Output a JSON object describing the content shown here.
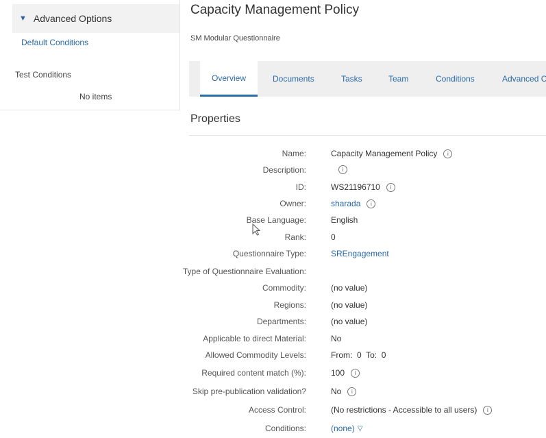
{
  "sidebar": {
    "section_title": "Advanced Options",
    "default_conditions": "Default Conditions",
    "test_conditions": "Test Conditions",
    "no_items": "No items"
  },
  "header": {
    "title": "Capacity Management Policy",
    "subtitle": "SM Modular Questionnaire"
  },
  "tabs": [
    "Overview",
    "Documents",
    "Tasks",
    "Team",
    "Conditions",
    "Advanced C"
  ],
  "properties": {
    "title": "Properties",
    "rows": [
      {
        "label": "Name:",
        "value": "Capacity Management Policy"
      },
      {
        "label": "Description:",
        "value": ""
      },
      {
        "label": "ID:",
        "value": "WS21196710"
      },
      {
        "label": "Owner:",
        "value": "sharada"
      },
      {
        "label": "Base Language:",
        "value": "English"
      },
      {
        "label": "Rank:",
        "value": "0"
      },
      {
        "label": "Questionnaire Type:",
        "value": "SREngagement"
      },
      {
        "label": "Type of Questionnaire Evaluation:",
        "value": ""
      },
      {
        "label": "Commodity:",
        "value": "(no value)"
      },
      {
        "label": "Regions:",
        "value": "(no value)"
      },
      {
        "label": "Departments:",
        "value": "(no value)"
      },
      {
        "label": "Applicable to direct Material:",
        "value": "No"
      },
      {
        "label": "Allowed Commodity Levels:",
        "value": "From:  0  To:  0"
      },
      {
        "label": "Required content match (%):",
        "value": "100"
      },
      {
        "label": "Skip pre-publication validation?",
        "value": "No"
      },
      {
        "label": "Access Control:",
        "value": "(No restrictions - Accessible to all users)"
      },
      {
        "label": "Conditions:",
        "value": "(none)"
      }
    ]
  },
  "icons": {
    "info": "info-icon",
    "chevron": "chevron-down-icon",
    "cursor": "mouse-pointer-icon"
  },
  "colors": {
    "link": "#2a6aa8",
    "tab_bar": "#efefef",
    "header_bg": "#f2f2f2"
  }
}
